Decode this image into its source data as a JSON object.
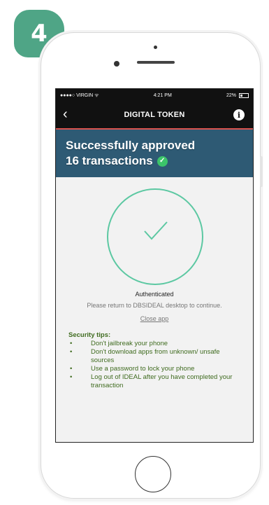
{
  "step": {
    "number": "4"
  },
  "statusbar": {
    "carrier": "●●●●○ VIRGIN ᯤ",
    "time": "4:21 PM",
    "battery": "22%"
  },
  "navbar": {
    "title": "DIGITAL TOKEN",
    "back_icon": "‹",
    "info_icon": "i"
  },
  "banner": {
    "line1": "Successfully approved",
    "line2": "16 transactions",
    "check_icon": "✓"
  },
  "content": {
    "status": "Authenticated",
    "message": "Please return to DBSIDEAL desktop to continue.",
    "close_link": "Close app"
  },
  "tips": {
    "title": "Security tips:",
    "items": [
      "Don't jailbreak your phone",
      "Don't download apps from unknown/ unsafe sources",
      "Use a password to lock your phone",
      "Log out of IDEAL after you have completed your transaction"
    ]
  },
  "colors": {
    "accent": "#4fa586",
    "banner": "#2e5a74",
    "success_ring": "#5cc8a2",
    "tips_text": "#3f6b1f",
    "nav_underline": "#d9534f"
  }
}
